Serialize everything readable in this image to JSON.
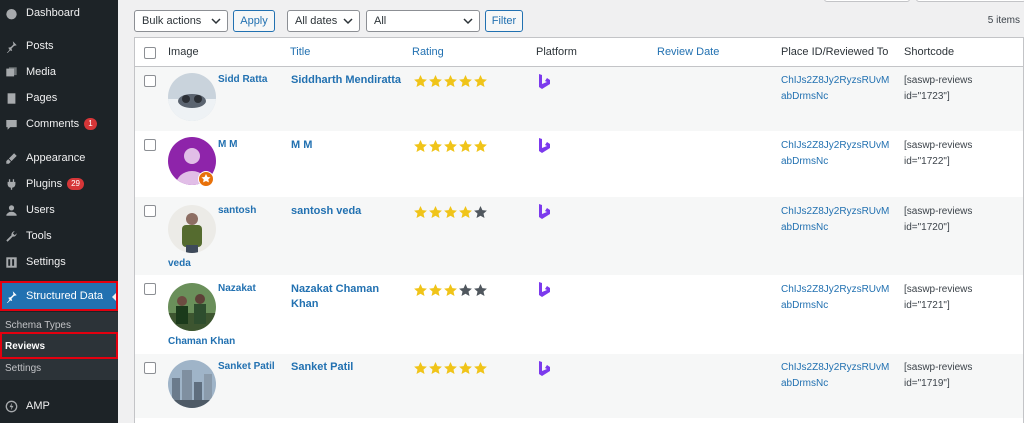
{
  "sidebar": {
    "items": [
      {
        "label": "Dashboard",
        "icon": "dashboard-icon"
      },
      {
        "label": "Posts",
        "icon": "pin-icon"
      },
      {
        "label": "Media",
        "icon": "media-icon"
      },
      {
        "label": "Pages",
        "icon": "pages-icon"
      },
      {
        "label": "Comments",
        "icon": "comment-icon",
        "badge": "1"
      },
      {
        "label": "Appearance",
        "icon": "brush-icon"
      },
      {
        "label": "Plugins",
        "icon": "plugin-icon",
        "badge": "29"
      },
      {
        "label": "Users",
        "icon": "user-icon"
      },
      {
        "label": "Tools",
        "icon": "wrench-icon"
      },
      {
        "label": "Settings",
        "icon": "settings-icon"
      },
      {
        "label": "Structured Data",
        "icon": "pin-icon"
      },
      {
        "label": "AMP",
        "icon": "amp-icon"
      }
    ],
    "submenu": [
      "Schema Types",
      "Reviews",
      "Settings"
    ]
  },
  "toolbar": {
    "bulk_actions": "Bulk actions",
    "apply": "Apply",
    "all_dates": "All dates",
    "all": "All",
    "filter": "Filter",
    "items_count": "5 items"
  },
  "table": {
    "headers": [
      "Image",
      "Title",
      "Rating",
      "Platform",
      "Review Date",
      "Place ID/Reviewed To",
      "Shortcode"
    ],
    "rows": [
      {
        "name": "Sidd Ratta",
        "name2": "",
        "title": "Siddharth Mendiratta",
        "rating": 5,
        "place": "ChIJs2Z8Jy2RyzsRUvMabDrmsNc",
        "shortcode": "[saswp-reviews id=\"1723\"]"
      },
      {
        "name": "M M",
        "name2": "",
        "title": "M M",
        "rating": 5,
        "place": "ChIJs2Z8Jy2RyzsRUvMabDrmsNc",
        "shortcode": "[saswp-reviews id=\"1722\"]"
      },
      {
        "name": "santosh",
        "name2": "veda",
        "title": "santosh veda",
        "rating": 4,
        "place": "ChIJs2Z8Jy2RyzsRUvMabDrmsNc",
        "shortcode": "[saswp-reviews id=\"1720\"]"
      },
      {
        "name": "Nazakat",
        "name2": "Chaman Khan",
        "title": "Nazakat Chaman Khan",
        "rating": 3,
        "place": "ChIJs2Z8Jy2RyzsRUvMabDrmsNc",
        "shortcode": "[saswp-reviews id=\"1721\"]"
      },
      {
        "name": "Sanket Patil",
        "name2": "",
        "title": "Sanket Patil",
        "rating": 5,
        "place": "ChIJs2Z8Jy2RyzsRUvMabDrmsNc",
        "shortcode": "[saswp-reviews id=\"1719\"]"
      }
    ]
  },
  "colors": {
    "accent": "#2271b1",
    "sidebar_bg": "#1d2327",
    "star_filled": "#f0c419",
    "star_empty": "#50575e",
    "platform": "#7c3aed",
    "highlight_box": "#e3000f"
  }
}
